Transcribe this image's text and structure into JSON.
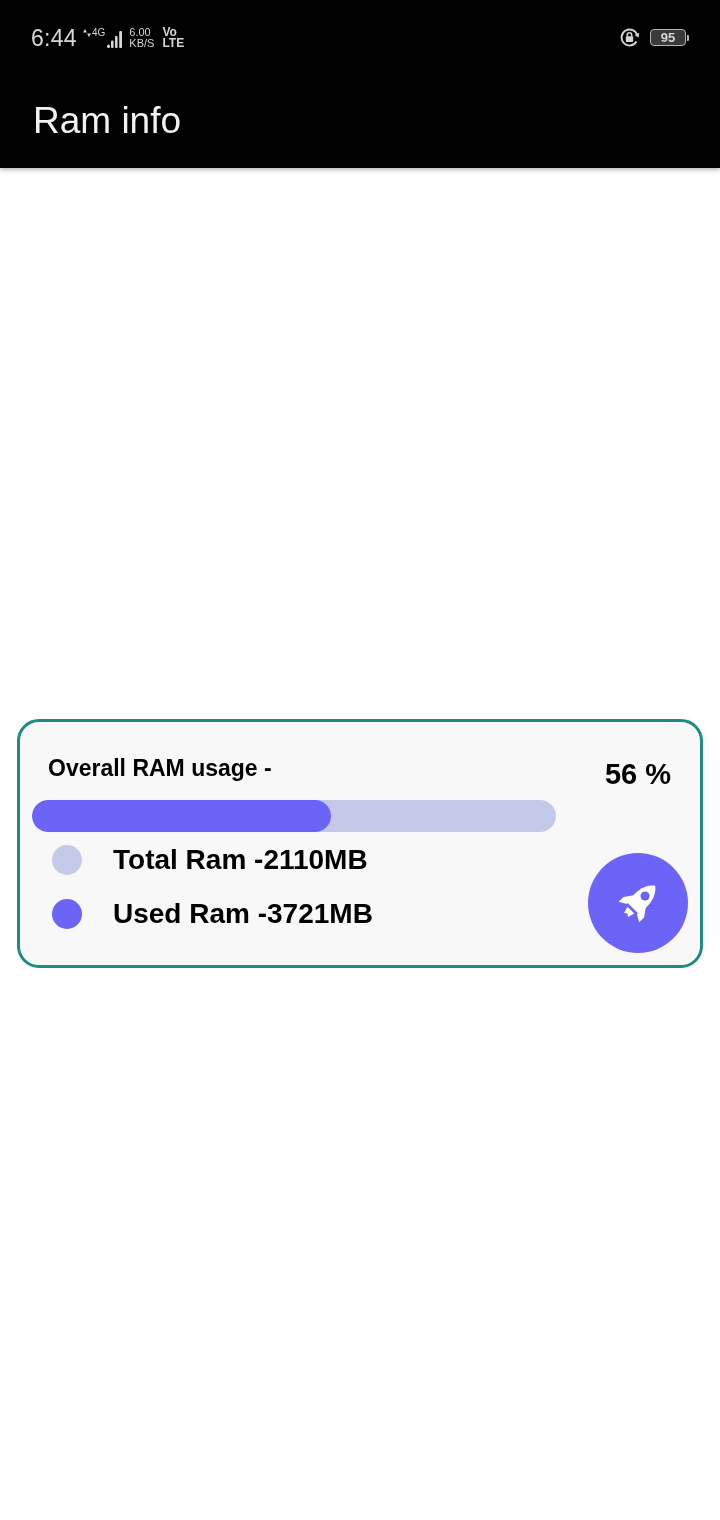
{
  "status_bar": {
    "time": "6:44",
    "network": "4G",
    "speed": "6.00",
    "speed_unit": "KB/S",
    "volte": [
      "Vo",
      "LTE"
    ],
    "battery": "95"
  },
  "app_bar": {
    "title": "Ram info"
  },
  "ram_card": {
    "title": "Overall RAM usage -",
    "percent": "56 %",
    "usage_bar": {
      "level": 0.57
    },
    "legend": [
      {
        "label": "Total Ram -2110MB",
        "color": "#c5cae9"
      },
      {
        "label": "Used Ram -3721MB",
        "color": "#6c63f7"
      }
    ]
  }
}
